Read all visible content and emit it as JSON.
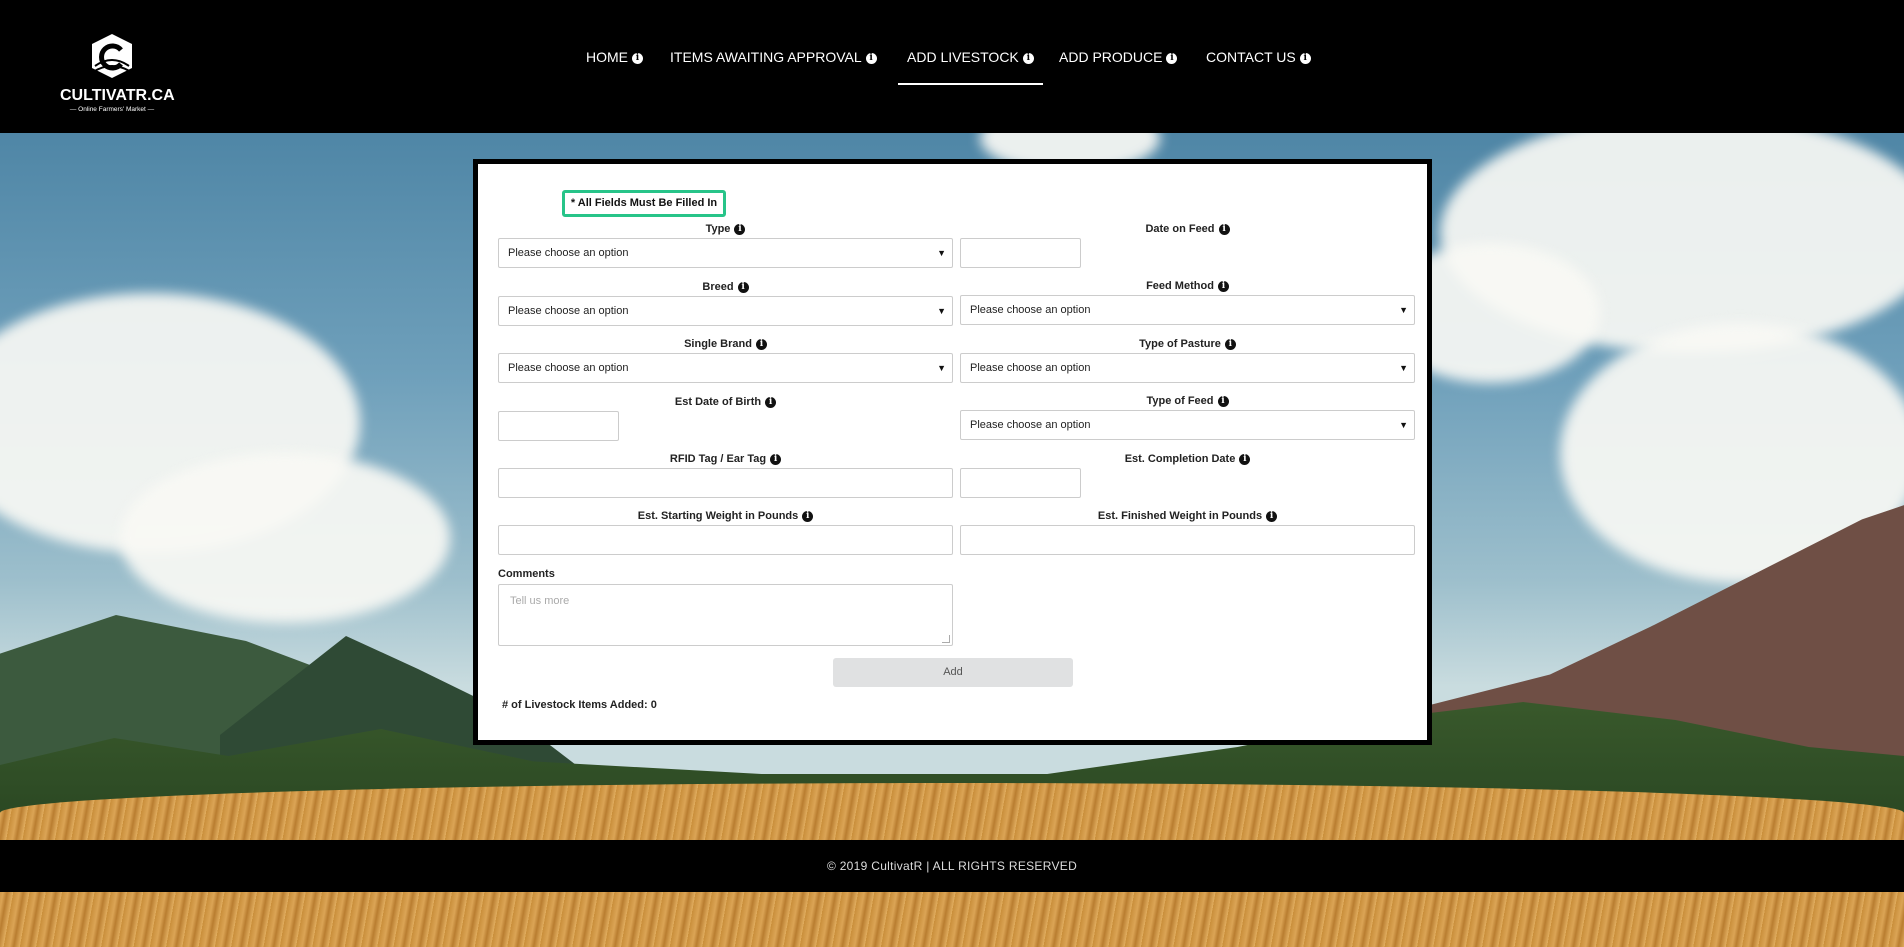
{
  "brand": {
    "name": "CULTIVATR.CA",
    "tagline": "— Online Farmers' Market —"
  },
  "nav": {
    "items": [
      {
        "label": "HOME",
        "active": false
      },
      {
        "label": "ITEMS AWAITING APPROVAL",
        "active": false
      },
      {
        "label": "ADD LIVESTOCK",
        "active": true
      },
      {
        "label": "ADD PRODUCE",
        "active": false
      },
      {
        "label": "CONTACT US",
        "active": false
      }
    ]
  },
  "form": {
    "notice": "* All Fields Must Be Filled In",
    "type_label": "Type",
    "type_value": "Please choose an option",
    "date_on_feed_label": "Date on Feed",
    "breed_label": "Breed",
    "breed_value": "Please choose an option",
    "feed_method_label": "Feed Method",
    "feed_method_value": "Please choose an option",
    "single_brand_label": "Single Brand",
    "single_brand_value": "Please choose an option",
    "pasture_label": "Type of Pasture",
    "pasture_value": "Please choose an option",
    "birth_label": "Est Date of Birth",
    "feed_type_label": "Type of Feed",
    "feed_type_value": "Please choose an option",
    "rfid_label": "RFID Tag / Ear Tag",
    "completion_label": "Est. Completion Date",
    "start_weight_label": "Est. Starting Weight in Pounds",
    "finish_weight_label": "Est. Finished Weight in Pounds",
    "comments_label": "Comments",
    "comments_placeholder": "Tell us more",
    "add_button": "Add",
    "count_text": "# of Livestock Items Added: 0"
  },
  "footer": {
    "text": "© 2019 CultivatR | ALL RIGHTS RESERVED"
  },
  "colors": {
    "notice_border": "#27c489",
    "header_bg": "#000000"
  }
}
